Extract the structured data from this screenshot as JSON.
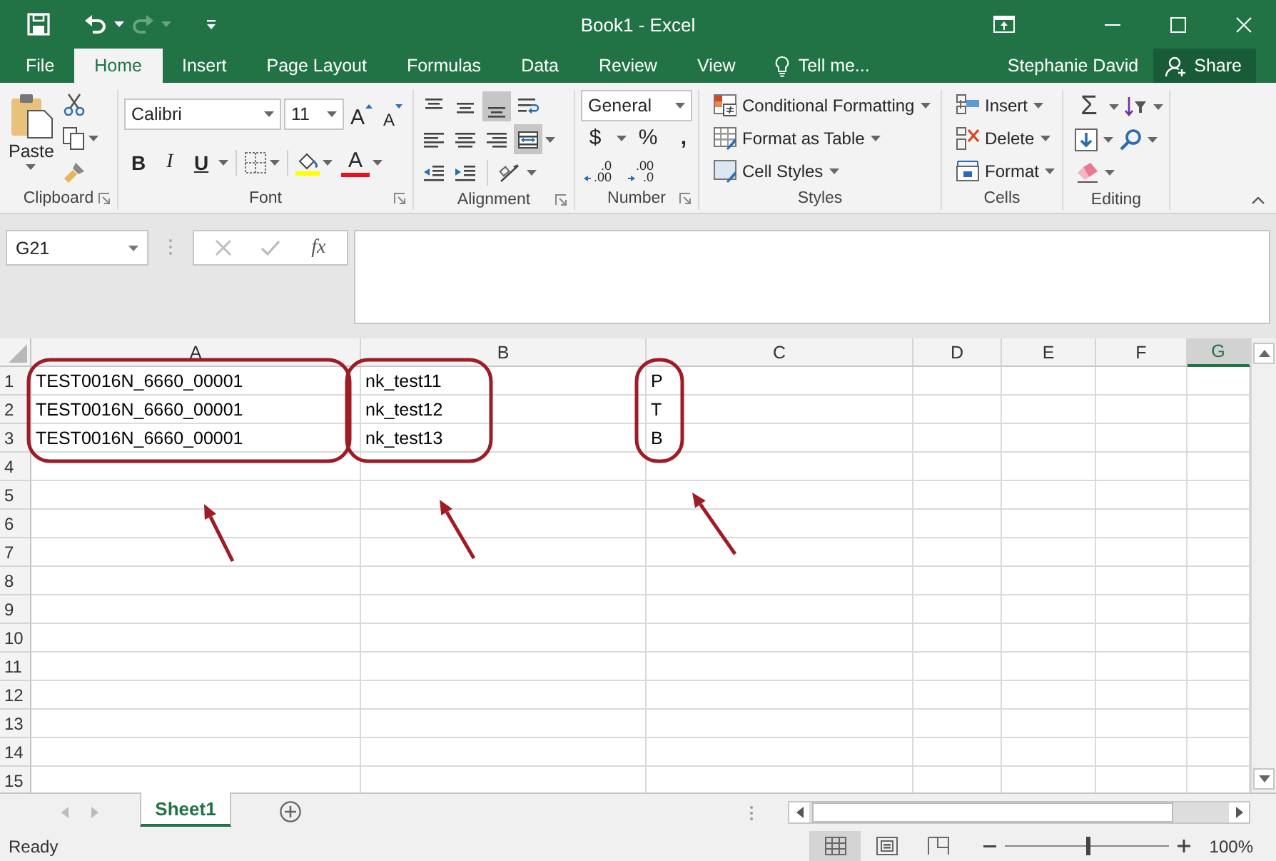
{
  "window": {
    "title": "Book1 - Excel"
  },
  "quick_access": [
    {
      "kind": "save",
      "disabled": false
    },
    {
      "kind": "undo",
      "disabled": false
    },
    {
      "kind": "redo",
      "disabled": true
    }
  ],
  "tabs": [
    {
      "label": "File",
      "selected": false
    },
    {
      "label": "Home",
      "selected": true
    },
    {
      "label": "Insert",
      "selected": false
    },
    {
      "label": "Page Layout",
      "selected": false
    },
    {
      "label": "Formulas",
      "selected": false
    },
    {
      "label": "Data",
      "selected": false
    },
    {
      "label": "Review",
      "selected": false
    },
    {
      "label": "View",
      "selected": false
    }
  ],
  "tell_me": "Tell me...",
  "user": "Stephanie David",
  "share_button": "Share",
  "ribbon": [
    {
      "kind": "clipboard",
      "label": "Clipboard",
      "launcher": true,
      "paste": "Paste"
    },
    {
      "kind": "font",
      "label": "Font",
      "launcher": true,
      "font_name": "Calibri",
      "font_size": "11",
      "grow": "A",
      "shrink": "A",
      "styles": [
        {
          "kind": "bold",
          "label": "B"
        },
        {
          "kind": "italic",
          "label": "I"
        },
        {
          "kind": "underline",
          "label": "U"
        }
      ],
      "font_color": "A"
    },
    {
      "kind": "alignment",
      "label": "Alignment",
      "launcher": true,
      "buttons": [
        {
          "kind": "align-top",
          "selected": false
        },
        {
          "kind": "align-middle",
          "selected": false
        },
        {
          "kind": "align-bottom",
          "selected": true
        },
        {
          "kind": "wrap",
          "selected": false
        },
        {
          "kind": "align-left",
          "selected": false
        },
        {
          "kind": "align-center",
          "selected": false
        },
        {
          "kind": "align-right",
          "selected": false
        },
        {
          "kind": "merge",
          "selected": true
        },
        {
          "kind": "outdent",
          "selected": false
        },
        {
          "kind": "indent",
          "selected": false
        },
        {
          "kind": "orientation",
          "selected": false
        }
      ]
    },
    {
      "kind": "number",
      "label": "Number",
      "launcher": true,
      "format": "General",
      "currency": "$",
      "percent": "%",
      "comma": ",",
      "increase_decimal": [
        ".0",
        ".00"
      ],
      "decrease_decimal": [
        ".00",
        ".0"
      ]
    },
    {
      "kind": "styles",
      "label": "Styles",
      "launcher": false,
      "commands": [
        {
          "kind": "conditional",
          "label": "Conditional Formatting"
        },
        {
          "kind": "table",
          "label": "Format as Table"
        },
        {
          "kind": "cell-styles",
          "label": "Cell Styles"
        }
      ]
    },
    {
      "kind": "cells",
      "label": "Cells",
      "launcher": false,
      "commands": [
        {
          "kind": "insert",
          "label": "Insert"
        },
        {
          "kind": "delete",
          "label": "Delete"
        },
        {
          "kind": "format",
          "label": "Format"
        }
      ]
    },
    {
      "kind": "editing",
      "label": "Editing",
      "launcher": false,
      "sum": "Σ"
    }
  ],
  "formula_bar": {
    "name_box": "G21",
    "function_label": "fx"
  },
  "columns": [
    {
      "label": "A",
      "selected": false,
      "circled": true
    },
    {
      "label": "B",
      "selected": false,
      "circled": true
    },
    {
      "label": "C",
      "selected": false,
      "circled": true
    },
    {
      "label": "D",
      "selected": false,
      "circled": false
    },
    {
      "label": "E",
      "selected": false,
      "circled": false
    },
    {
      "label": "F",
      "selected": false,
      "circled": false
    },
    {
      "label": "G",
      "selected": true,
      "circled": false
    }
  ],
  "rows": [
    {
      "label": "1",
      "cells": [
        "TEST0016N_6660_00001",
        "nk_test11",
        "P"
      ]
    },
    {
      "label": "2",
      "cells": [
        "TEST0016N_6660_00001",
        "nk_test12",
        "T"
      ]
    },
    {
      "label": "3",
      "cells": [
        "TEST0016N_6660_00001",
        "nk_test13",
        "B"
      ]
    },
    {
      "label": "4"
    },
    {
      "label": "5"
    },
    {
      "label": "6"
    },
    {
      "label": "7"
    },
    {
      "label": "8"
    },
    {
      "label": "9"
    },
    {
      "label": "10"
    },
    {
      "label": "11"
    },
    {
      "label": "12"
    },
    {
      "label": "13"
    },
    {
      "label": "14"
    },
    {
      "label": "15"
    }
  ],
  "sheet_tabs": [
    {
      "label": "Sheet1",
      "selected": true
    }
  ],
  "status_bar": {
    "status": "Ready",
    "views": [
      {
        "kind": "normal",
        "selected": true
      },
      {
        "kind": "page-layout",
        "selected": false
      },
      {
        "kind": "page-break",
        "selected": false
      }
    ],
    "zoom": {
      "level": 0.5,
      "reading": "100%"
    }
  }
}
